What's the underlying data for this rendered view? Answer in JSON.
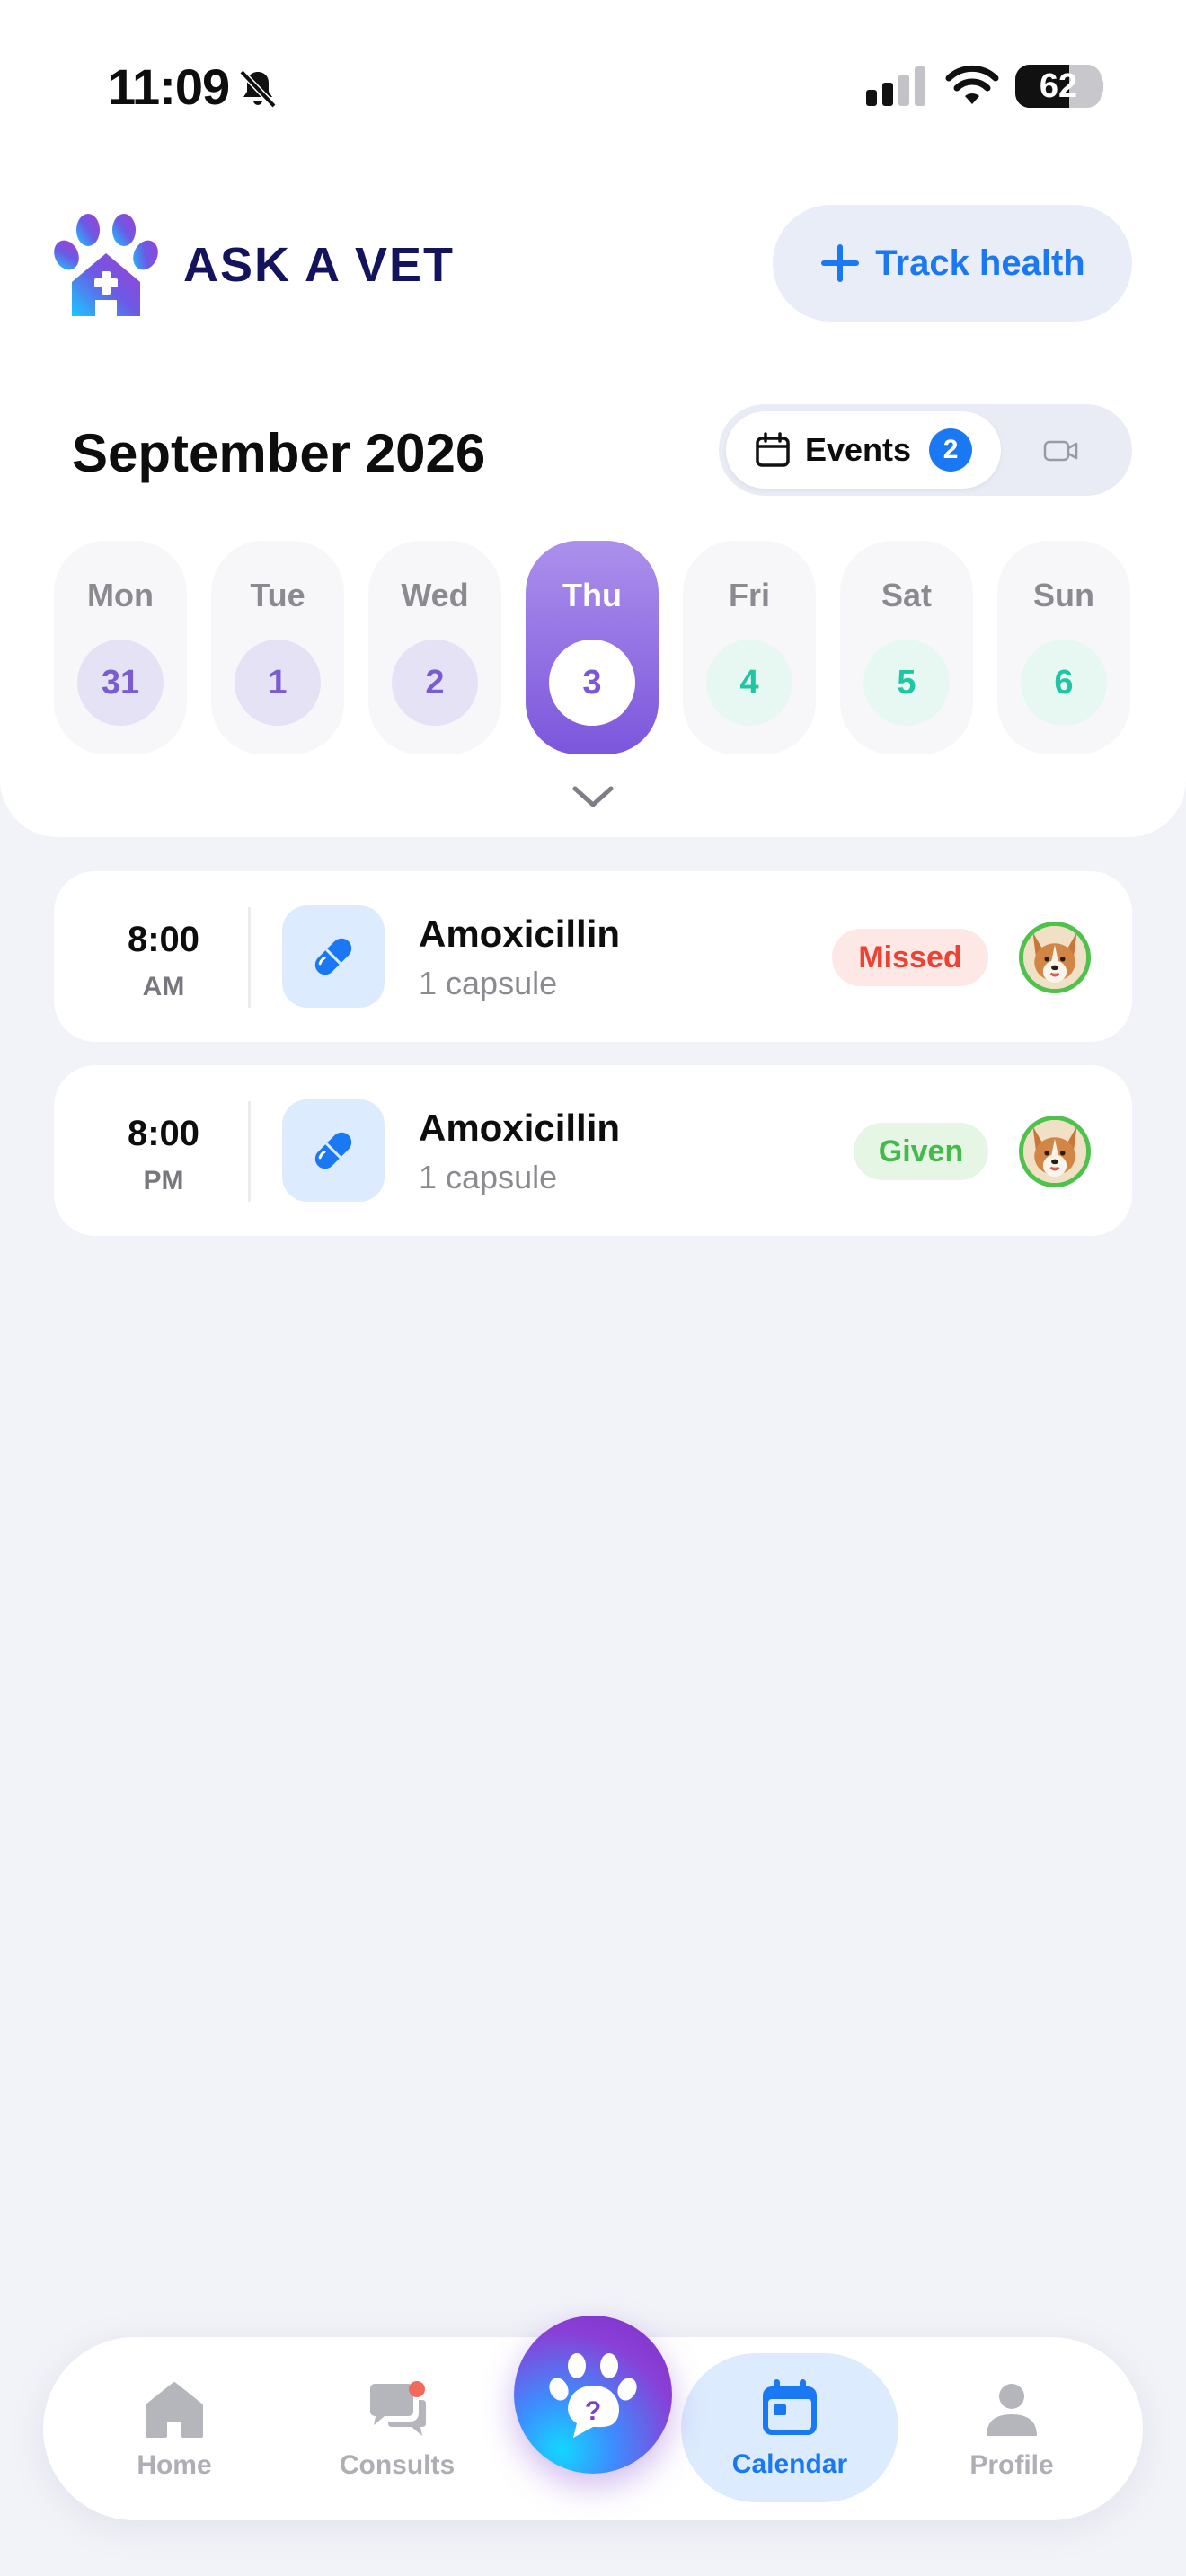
{
  "status_bar": {
    "time": "11:09",
    "battery": "62",
    "battery_level": 0.62
  },
  "header": {
    "app_name": "ASK A VET",
    "track_button_label": "Track health"
  },
  "calendar": {
    "month_title": "September 2026",
    "events_tab_label": "Events",
    "events_count": "2",
    "days": [
      {
        "name": "Mon",
        "number": "31",
        "state": "past"
      },
      {
        "name": "Tue",
        "number": "1",
        "state": "past"
      },
      {
        "name": "Wed",
        "number": "2",
        "state": "past"
      },
      {
        "name": "Thu",
        "number": "3",
        "state": "selected"
      },
      {
        "name": "Fri",
        "number": "4",
        "state": "future"
      },
      {
        "name": "Sat",
        "number": "5",
        "state": "future"
      },
      {
        "name": "Sun",
        "number": "6",
        "state": "future"
      }
    ]
  },
  "events": [
    {
      "time": "8:00",
      "period": "AM",
      "name": "Amoxicillin",
      "dose": "1 capsule",
      "status": "Missed"
    },
    {
      "time": "8:00",
      "period": "PM",
      "name": "Amoxicillin",
      "dose": "1 capsule",
      "status": "Given"
    }
  ],
  "bottom_nav": {
    "items": [
      {
        "label": "Home",
        "icon": "home-icon"
      },
      {
        "label": "Consults",
        "icon": "chat-icon"
      },
      {
        "label": "Calendar",
        "icon": "calendar-icon"
      },
      {
        "label": "Profile",
        "icon": "person-icon"
      }
    ],
    "fab_icon": "paw-question-icon",
    "active": "Calendar"
  },
  "colors": {
    "accent": "#1a78f2",
    "brand_purple": "#7c56dc",
    "missed": "#ec4234",
    "given": "#46b94c"
  }
}
